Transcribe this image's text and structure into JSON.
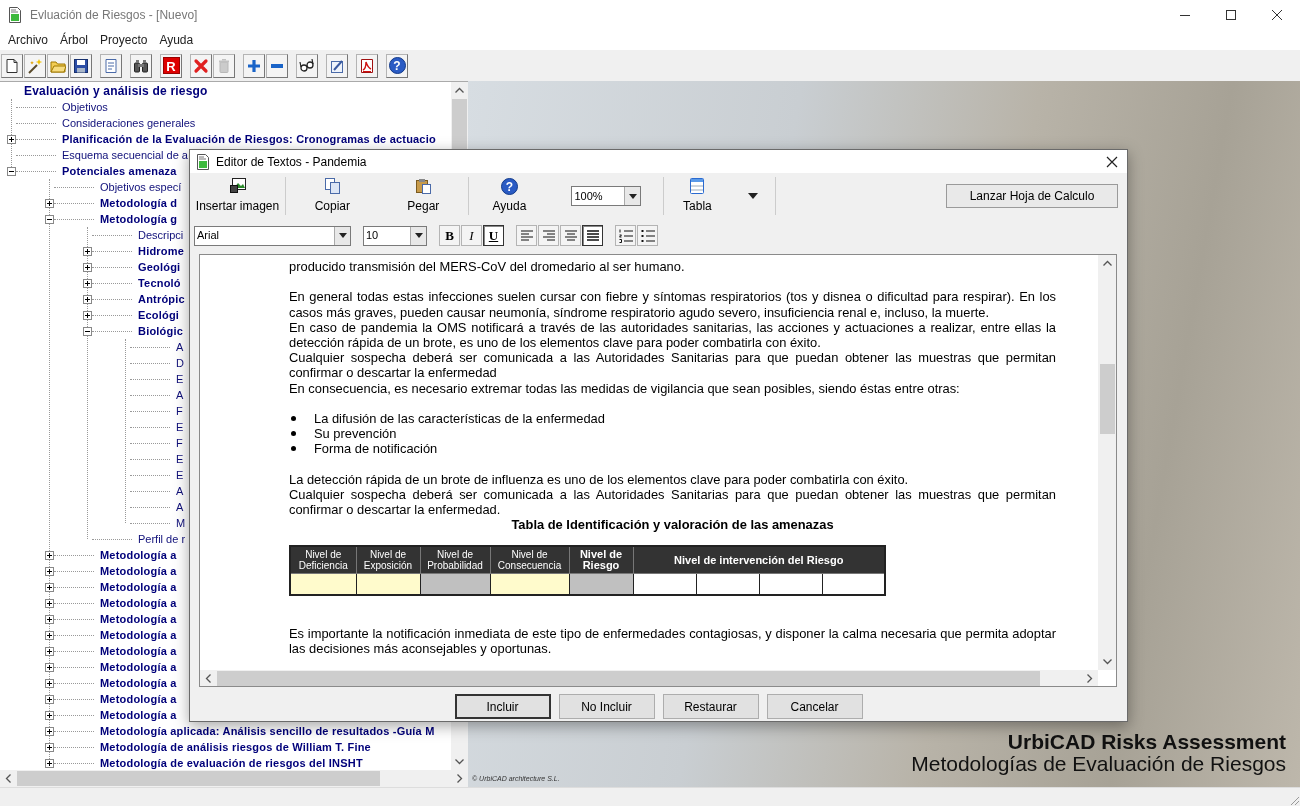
{
  "window": {
    "title": "Evluación de Riesgos - [Nuevo]"
  },
  "menu": [
    "Archivo",
    "Árbol",
    "Proyecto",
    "Ayuda"
  ],
  "toolbar": [
    [
      {
        "kind": "new",
        "disabled": false
      },
      {
        "kind": "wand",
        "disabled": false
      },
      {
        "kind": "open",
        "disabled": false
      },
      {
        "kind": "save",
        "disabled": false
      }
    ],
    [
      {
        "kind": "preview",
        "disabled": false
      }
    ],
    [
      {
        "kind": "find",
        "disabled": false
      }
    ],
    [
      {
        "kind": "letter",
        "label": "R",
        "disabled": false
      }
    ],
    [
      {
        "kind": "delete",
        "disabled": false
      },
      {
        "kind": "trash",
        "disabled": true
      }
    ],
    [
      {
        "kind": "add",
        "disabled": false
      },
      {
        "kind": "remove",
        "disabled": false
      }
    ],
    [
      {
        "kind": "glasses",
        "disabled": false
      }
    ],
    [
      {
        "kind": "edit",
        "disabled": false
      }
    ],
    [
      {
        "kind": "pdf",
        "disabled": false
      }
    ],
    [
      {
        "kind": "help",
        "label": "?",
        "disabled": false
      }
    ]
  ],
  "tree": {
    "items": [
      {
        "label": "Evaluación y análisis de riesgo",
        "kind": "folder",
        "children": [
          {
            "label": "Objetivos",
            "kind": "page"
          },
          {
            "label": "Consideraciones generales",
            "kind": "page"
          },
          {
            "label": "Planificación de la Evaluación de Riesgos: Cronogramas de actuacio",
            "kind": "folder",
            "expanded": false
          },
          {
            "label": "Esquema secuencial de a",
            "kind": "page"
          },
          {
            "label": "Potenciales amenaza",
            "kind": "folder",
            "expanded": true,
            "children": [
              {
                "label": "Objetivos especí",
                "kind": "page"
              },
              {
                "label": "Metodología d",
                "kind": "folder",
                "expanded": false
              },
              {
                "label": "Metodología g",
                "kind": "folder",
                "expanded": true,
                "children": [
                  {
                    "label": "Descripci",
                    "kind": "page"
                  },
                  {
                    "label": "Hidrome",
                    "kind": "folder",
                    "expanded": false
                  },
                  {
                    "label": "Geológi",
                    "kind": "folder",
                    "expanded": false
                  },
                  {
                    "label": "Tecnoló",
                    "kind": "folder",
                    "expanded": false
                  },
                  {
                    "label": "Antrópic",
                    "kind": "folder",
                    "expanded": false
                  },
                  {
                    "label": "Ecológi",
                    "kind": "folder",
                    "expanded": false
                  },
                  {
                    "label": "Biológic",
                    "kind": "folder",
                    "expanded": true,
                    "children": [
                      {
                        "label": "A",
                        "kind": "page"
                      },
                      {
                        "label": "D",
                        "kind": "page"
                      },
                      {
                        "label": "E",
                        "kind": "page"
                      },
                      {
                        "label": "A",
                        "kind": "page"
                      },
                      {
                        "label": "F",
                        "kind": "page"
                      },
                      {
                        "label": "E",
                        "kind": "page"
                      },
                      {
                        "label": "F",
                        "kind": "page"
                      },
                      {
                        "label": "E",
                        "kind": "page"
                      },
                      {
                        "label": "E",
                        "kind": "page"
                      },
                      {
                        "label": "A",
                        "kind": "page"
                      },
                      {
                        "label": "A",
                        "kind": "page"
                      },
                      {
                        "label": "M",
                        "kind": "page"
                      }
                    ]
                  },
                  {
                    "label": "Perfil de r",
                    "kind": "page"
                  }
                ]
              },
              {
                "label": "Metodología a",
                "kind": "folder",
                "expanded": false
              },
              {
                "label": "Metodología a",
                "kind": "folder",
                "expanded": false
              },
              {
                "label": "Metodología a",
                "kind": "folder",
                "expanded": false
              },
              {
                "label": "Metodología a",
                "kind": "folder",
                "expanded": false
              },
              {
                "label": "Metodología a",
                "kind": "folder",
                "expanded": false
              },
              {
                "label": "Metodología a",
                "kind": "folder",
                "expanded": false
              },
              {
                "label": "Metodología a",
                "kind": "folder",
                "expanded": false
              },
              {
                "label": "Metodología a",
                "kind": "folder",
                "expanded": false
              },
              {
                "label": "Metodología a",
                "kind": "folder",
                "expanded": false
              },
              {
                "label": "Metodología a",
                "kind": "folder",
                "expanded": false
              },
              {
                "label": "Metodología a",
                "kind": "folder",
                "expanded": false
              },
              {
                "label": "Metodología aplicada: Análisis sencillo de resultados -Guía M",
                "kind": "folder",
                "expanded": false
              },
              {
                "label": "Metodología de análisis riesgos de William T. Fine",
                "kind": "folder",
                "expanded": false
              },
              {
                "label": "Metodología de evaluación de riesgos del INSHT",
                "kind": "folder",
                "expanded": false
              }
            ]
          }
        ]
      }
    ]
  },
  "branding": {
    "title": "UrbiCAD Risks Assessment",
    "subtitle": "Metodologías de Evaluación de Riesgos",
    "copyright": "© UrbiCAD architecture S.L."
  },
  "dialog": {
    "title": "Editor de Textos - Pandemia",
    "toolbar": [
      [
        {
          "kind": "image",
          "label": "Insertar imagen"
        }
      ],
      [
        {
          "kind": "copy",
          "label": "Copiar"
        },
        {
          "kind": "paste",
          "label": "Pegar"
        }
      ],
      [
        {
          "kind": "help",
          "label": "Ayuda",
          "glyph": "?"
        },
        {
          "kind": "zoom",
          "value": "100%"
        }
      ],
      [
        {
          "kind": "table",
          "label": "Tabla"
        }
      ]
    ],
    "launch_button": "Lanzar Hoja de Calculo",
    "font": "Arial",
    "size": "10",
    "format_buttons": [
      [
        {
          "kind": "bold",
          "label": "B",
          "selected": false
        },
        {
          "kind": "italic",
          "label": "I",
          "selected": false
        },
        {
          "kind": "underline",
          "label": "U",
          "selected": true
        }
      ],
      [
        {
          "kind": "align-left",
          "selected": false
        },
        {
          "kind": "align-right",
          "selected": false
        },
        {
          "kind": "align-center",
          "selected": false
        },
        {
          "kind": "justify",
          "selected": true
        }
      ],
      [
        {
          "kind": "numbered-list",
          "selected": false
        },
        {
          "kind": "bullet-list",
          "selected": false
        }
      ]
    ],
    "document": [
      {
        "kind": "paragraph",
        "text": "producido transmisión del MERS-CoV del dromedario al ser humano."
      },
      {
        "kind": "blank"
      },
      {
        "kind": "paragraph",
        "text": "En general todas estas infecciones suelen cursar con fiebre y síntomas respiratorios (tos y disnea o dificultad para respirar). En los casos más graves, pueden causar neumonía, síndrome respiratorio agudo severo, insuficiencia renal e, incluso, la muerte."
      },
      {
        "kind": "paragraph",
        "text": "En caso de pandemia la OMS notificará a través de las autoridades sanitarias, las acciones y actuaciones a realizar, entre ellas la detección rápida de un brote, es uno de los elementos clave para poder combatirla con éxito."
      },
      {
        "kind": "paragraph",
        "text": "Cualquier sospecha deberá ser comunicada a las Autoridades Sanitarias para que puedan obtener las muestras que permitan confirmar o descartar la enfermedad"
      },
      {
        "kind": "paragraph",
        "text": "En consecuencia, es necesario extremar todas las medidas de vigilancia que sean posibles, siendo éstas entre otras:"
      },
      {
        "kind": "blank"
      },
      {
        "kind": "bullets",
        "items": [
          "La difusión de las características de la enfermedad",
          "Su prevención",
          "Forma de notificación"
        ]
      },
      {
        "kind": "blank"
      },
      {
        "kind": "paragraph",
        "text": "La detección rápida de un brote de influenza es uno de los elementos clave para poder combatirla con éxito."
      },
      {
        "kind": "paragraph",
        "text": "Cualquier sospecha deberá ser comunicada a las Autoridades Sanitarias para que puedan obtener las muestras que permitan confirmar o descartar la enfermedad."
      },
      {
        "kind": "heading",
        "text": "Tabla de Identificación y valoración de las amenazas"
      },
      {
        "kind": "table",
        "columns": [
          {
            "label": "Nivel de Deficiencia",
            "bold": false
          },
          {
            "label": "Nivel de Exposición",
            "bold": false
          },
          {
            "label": "Nivel de Probabilidad",
            "bold": false
          },
          {
            "label": "Nivel de Consecuencia",
            "bold": false
          },
          {
            "label": "Nivel de Riesgo",
            "bold": true
          },
          {
            "label": "Nivel de intervención del Riesgo",
            "bold": true
          }
        ],
        "cells": [
          {
            "color": "#fffbcc"
          },
          {
            "color": "#fffbcc"
          },
          {
            "color": "#c0c0c0"
          },
          {
            "color": "#fffbcc"
          },
          {
            "color": "#c0c0c0"
          },
          {
            "color": "#ffffff"
          },
          {
            "color": "#ffffff"
          },
          {
            "color": "#ffffff"
          },
          {
            "color": "#ffffff"
          }
        ]
      },
      {
        "kind": "blank"
      },
      {
        "kind": "blank"
      },
      {
        "kind": "paragraph",
        "text": "Es importante la notificación inmediata de este tipo de enfermedades contagiosas, y  disponer la calma necesaria que permita adoptar las decisiones más aconsejables y oportunas."
      }
    ],
    "buttons": [
      {
        "label": "Incluir",
        "default": true
      },
      {
        "label": "No Incluir",
        "default": false
      },
      {
        "label": "Restaurar",
        "default": false
      },
      {
        "label": "Cancelar",
        "default": false
      }
    ]
  }
}
